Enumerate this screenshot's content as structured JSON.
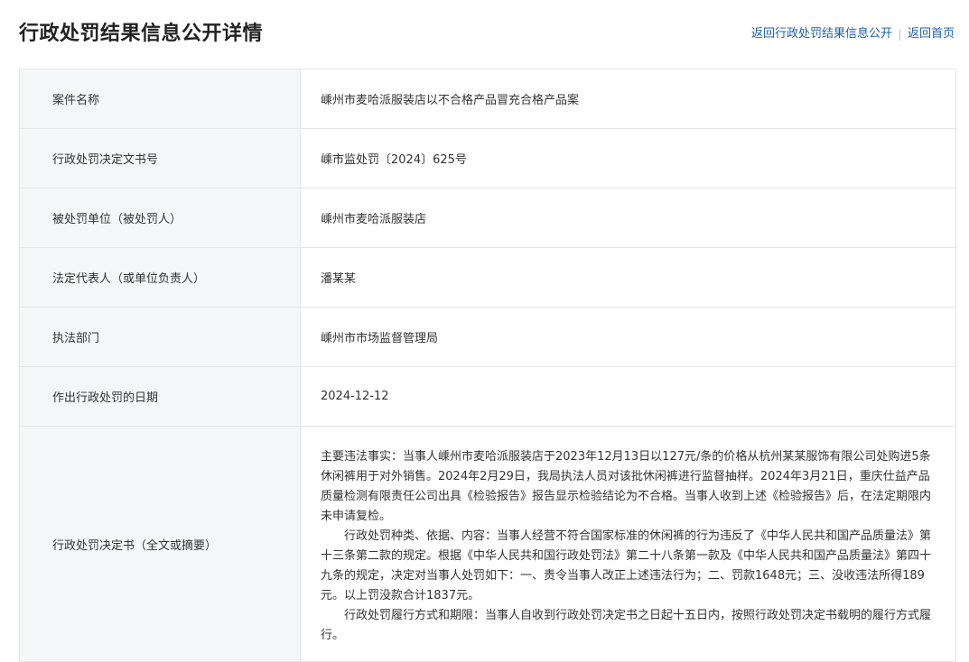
{
  "header": {
    "title": "行政处罚结果信息公开详情",
    "links": {
      "back_list": "返回行政处罚结果信息公开",
      "back_home": "返回首页"
    }
  },
  "details": {
    "case_name": {
      "label": "案件名称",
      "value": "嵊州市麦哈派服装店以不合格产品冒充合格产品案"
    },
    "document_number": {
      "label": "行政处罚决定文书号",
      "value": "嵊市监处罚〔2024〕625号"
    },
    "penalized_party": {
      "label": "被处罚单位（被处罚人）",
      "value": "嵊州市麦哈派服装店"
    },
    "legal_representative": {
      "label": "法定代表人（或单位负责人）",
      "value": "潘某某"
    },
    "enforcement_department": {
      "label": "执法部门",
      "value": "嵊州市市场监督管理局"
    },
    "decision_date": {
      "label": "作出行政处罚的日期",
      "value": "2024-12-12"
    },
    "decision_document": {
      "label": "行政处罚决定书（全文或摘要）",
      "paragraphs": [
        "主要违法事实：当事人嵊州市麦哈派服装店于2023年12月13日以127元/条的价格从杭州某某服饰有限公司处购进5条休闲裤用于对外销售。2024年2月29日，我局执法人员对该批休闲裤进行监督抽样。2024年3月21日，重庆仕益产品质量检测有限责任公司出具《检验报告》报告显示检验结论为不合格。当事人收到上述《检验报告》后，在法定期限内未申请复检。",
        "行政处罚种类、依据、内容：当事人经营不符合国家标准的休闲裤的行为违反了《中华人民共和国产品质量法》第十三条第二款的规定。根据《中华人民共和国行政处罚法》第二十八条第一款及《中华人民共和国产品质量法》第四十九条的规定，决定对当事人处罚如下：一、责令当事人改正上述违法行为；二、罚款1648元；三、没收违法所得189元。以上罚没款合计1837元。",
        "行政处罚履行方式和期限：当事人自收到行政处罚决定书之日起十五日内，按照行政处罚决定书载明的履行方式履行。"
      ]
    }
  },
  "colors": {
    "link": "#1f5fa6",
    "label_background": "#f5f6f7",
    "border": "#e6e6e6"
  }
}
